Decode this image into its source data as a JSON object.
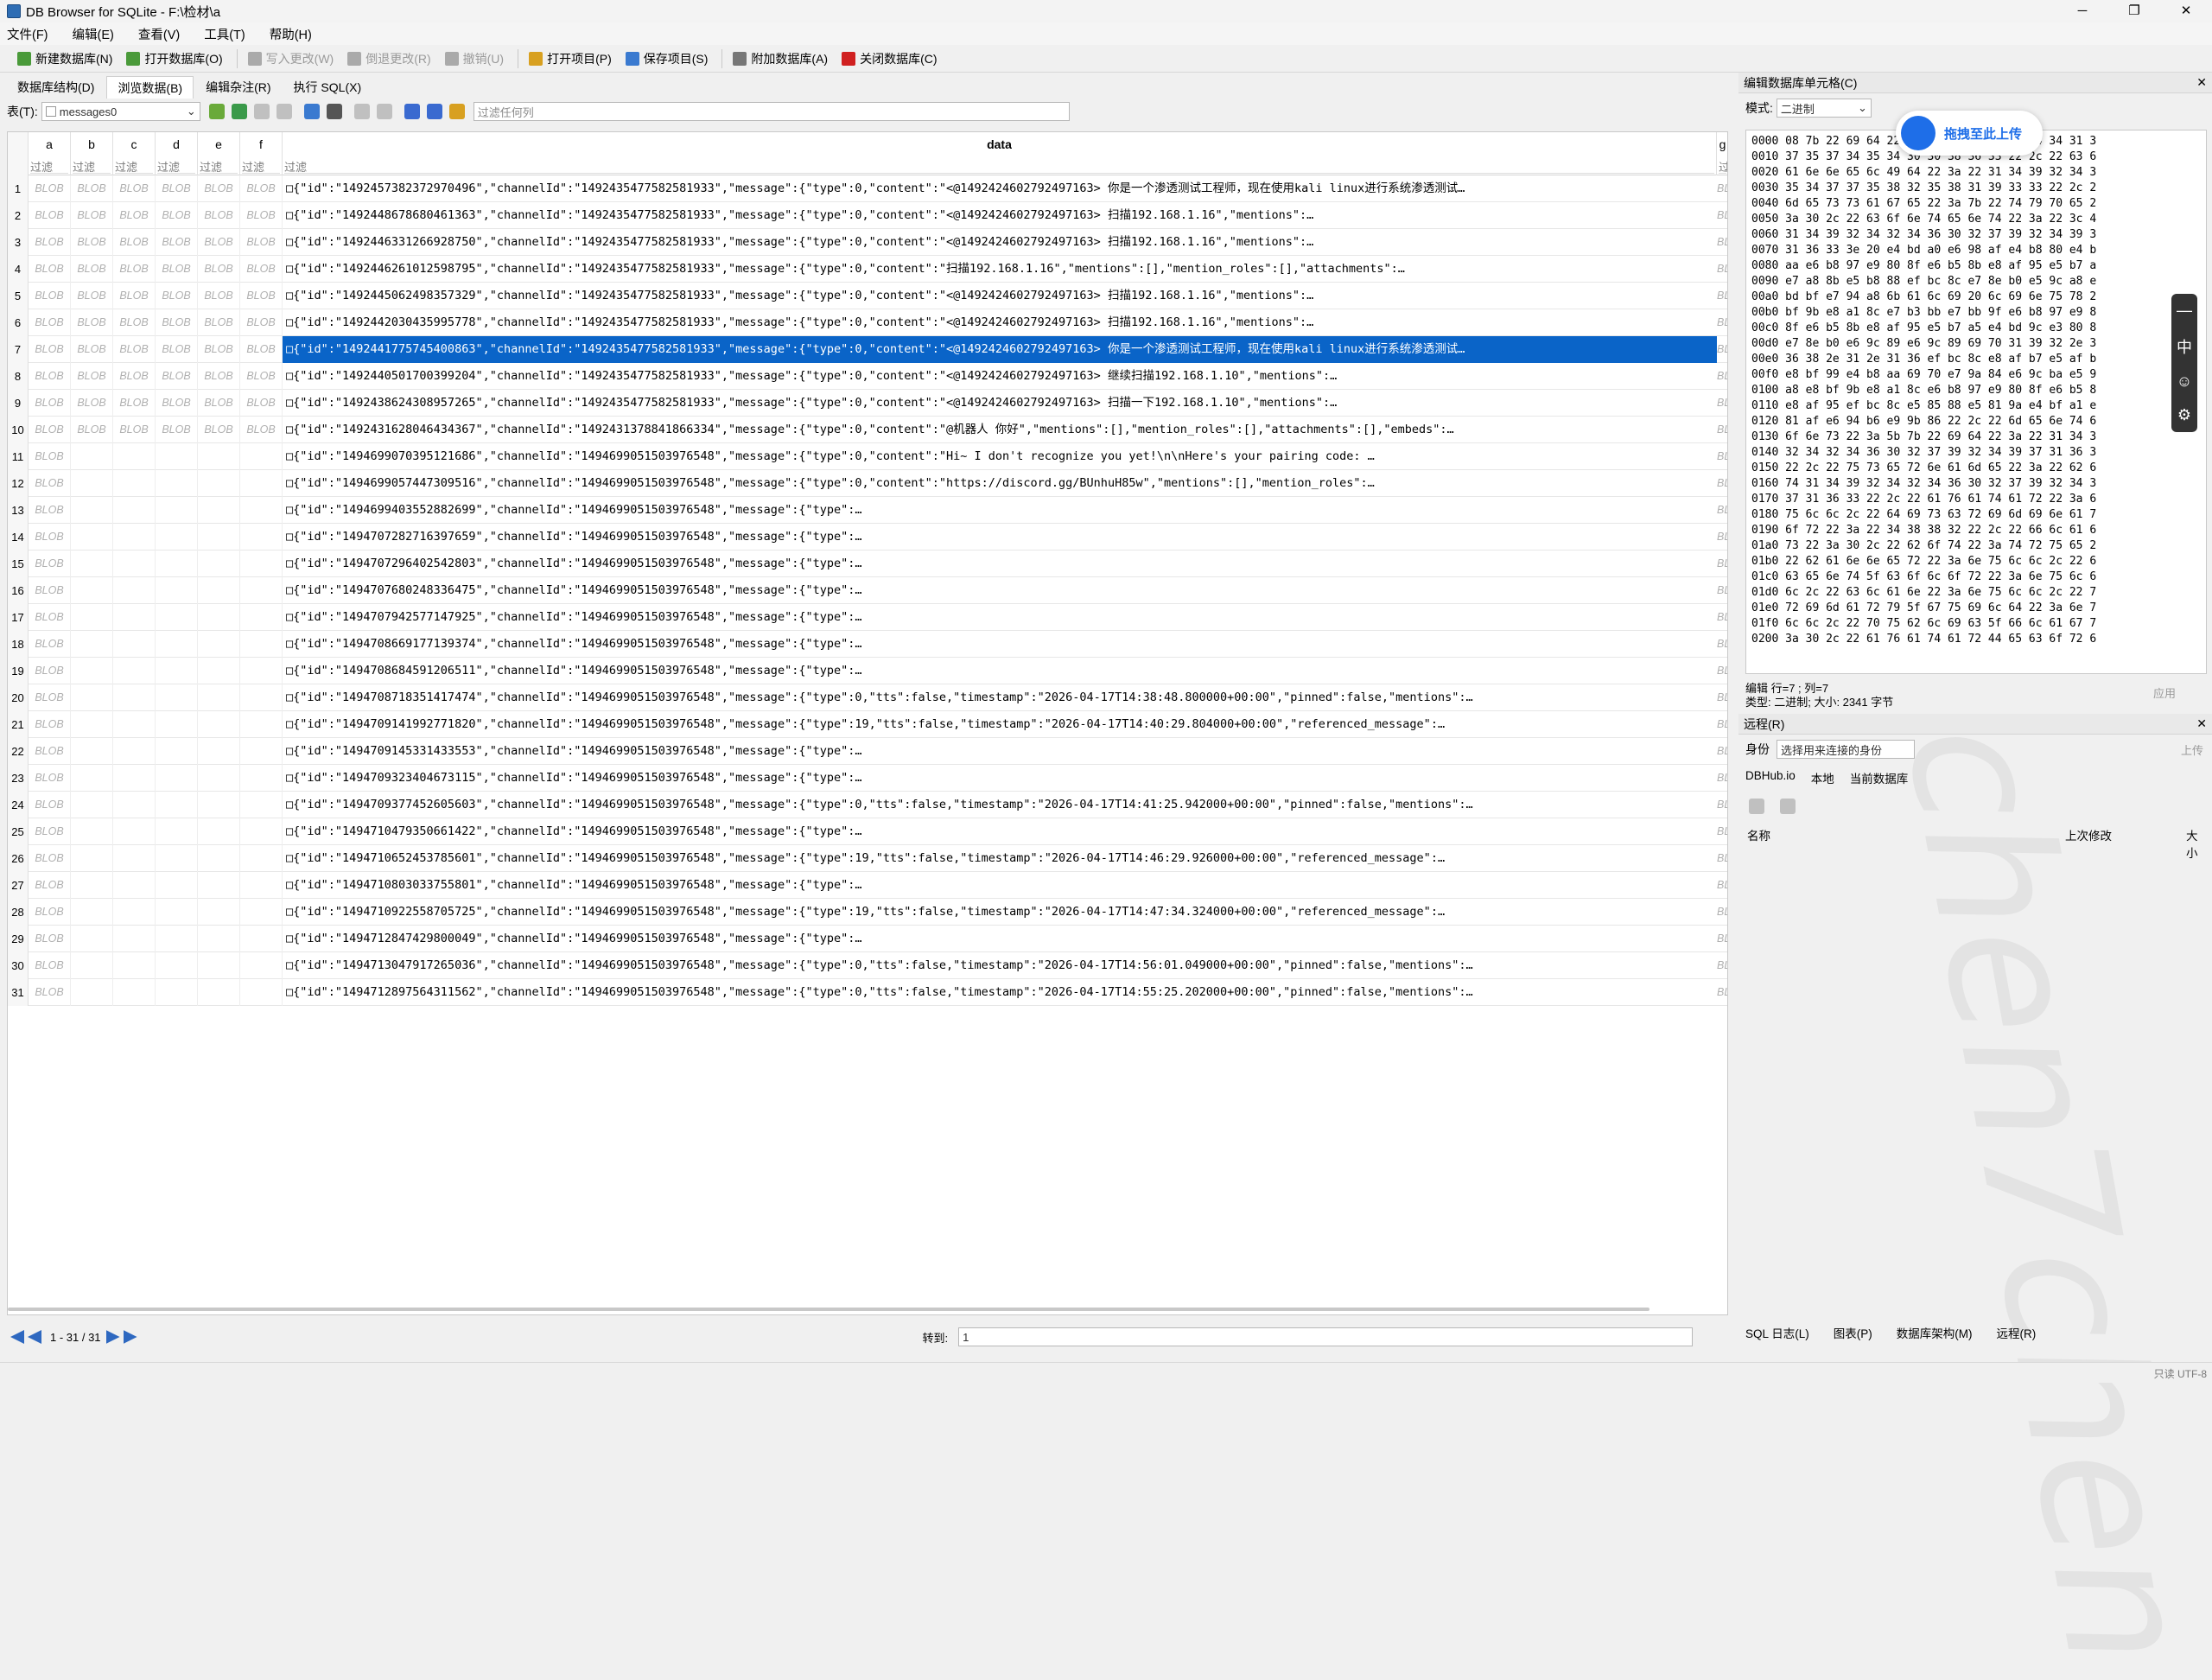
{
  "window": {
    "title": "DB Browser for SQLite - F:\\检材\\a",
    "min": "─",
    "max": "❐",
    "close": "✕"
  },
  "menu": [
    "文件(F)",
    "编辑(E)",
    "查看(V)",
    "工具(T)",
    "帮助(H)"
  ],
  "toolbar": [
    {
      "label": "新建数据库(N)",
      "color": "#4a9a3a",
      "disabled": false
    },
    {
      "label": "打开数据库(O)",
      "color": "#4a9a3a",
      "disabled": false
    },
    {
      "label": "写入更改(W)",
      "color": "#aaaaaa",
      "disabled": true
    },
    {
      "label": "倒退更改(R)",
      "color": "#aaaaaa",
      "disabled": true
    },
    {
      "label": "撤销(U)",
      "color": "#aaaaaa",
      "disabled": true
    },
    {
      "label": "打开项目(P)",
      "color": "#d8a020",
      "disabled": false
    },
    {
      "label": "保存项目(S)",
      "color": "#3a7ad0",
      "disabled": false
    },
    {
      "label": "附加数据库(A)",
      "color": "#777777",
      "disabled": false
    },
    {
      "label": "关闭数据库(C)",
      "color": "#d02020",
      "disabled": false
    }
  ],
  "tabs": [
    "数据库结构(D)",
    "浏览数据(B)",
    "编辑杂注(R)",
    "执行 SQL(X)"
  ],
  "filter": {
    "table_label": "表(T):",
    "table_value": "messages0",
    "filter_placeholder": "过滤任何列"
  },
  "columns": [
    "a",
    "b",
    "c",
    "d",
    "e",
    "f",
    "data",
    "g"
  ],
  "filter_label": "过滤",
  "blob": "BLOB",
  "rows": [
    {
      "n": "1",
      "full": true,
      "data": "□{\"id\":\"1492457382372970496\",\"channelId\":\"1492435477582581933\",\"message\":{\"type\":0,\"content\":\"<@1492424602792497163> 你是一个渗透测试工程师，现在使用kali linux进行系统渗透测试…"
    },
    {
      "n": "2",
      "full": true,
      "data": "□{\"id\":\"1492448678680461363\",\"channelId\":\"1492435477582581933\",\"message\":{\"type\":0,\"content\":\"<@1492424602792497163> 扫描192.168.1.16\",\"mentions\":…"
    },
    {
      "n": "3",
      "full": true,
      "data": "□{\"id\":\"1492446331266928750\",\"channelId\":\"1492435477582581933\",\"message\":{\"type\":0,\"content\":\"<@1492424602792497163> 扫描192.168.1.16\",\"mentions\":…"
    },
    {
      "n": "4",
      "full": true,
      "data": "□{\"id\":\"1492446261012598795\",\"channelId\":\"1492435477582581933\",\"message\":{\"type\":0,\"content\":\"扫描192.168.1.16\",\"mentions\":[],\"mention_roles\":[],\"attachments\":…"
    },
    {
      "n": "5",
      "full": true,
      "data": "□{\"id\":\"1492445062498357329\",\"channelId\":\"1492435477582581933\",\"message\":{\"type\":0,\"content\":\"<@1492424602792497163> 扫描192.168.1.16\",\"mentions\":…"
    },
    {
      "n": "6",
      "full": true,
      "data": "□{\"id\":\"1492442030435995778\",\"channelId\":\"1492435477582581933\",\"message\":{\"type\":0,\"content\":\"<@1492424602792497163> 扫描192.168.1.16\",\"mentions\":…"
    },
    {
      "n": "7",
      "full": true,
      "sel": true,
      "data": "□{\"id\":\"1492441775745400863\",\"channelId\":\"1492435477582581933\",\"message\":{\"type\":0,\"content\":\"<@1492424602792497163> 你是一个渗透测试工程师，现在使用kali linux进行系统渗透测试…"
    },
    {
      "n": "8",
      "full": true,
      "data": "□{\"id\":\"1492440501700399204\",\"channelId\":\"1492435477582581933\",\"message\":{\"type\":0,\"content\":\"<@1492424602792497163> 继续扫描192.168.1.10\",\"mentions\":…"
    },
    {
      "n": "9",
      "full": true,
      "data": "□{\"id\":\"1492438624308957265\",\"channelId\":\"1492435477582581933\",\"message\":{\"type\":0,\"content\":\"<@1492424602792497163> 扫描一下192.168.1.10\",\"mentions\":…"
    },
    {
      "n": "10",
      "full": true,
      "data": "□{\"id\":\"1492431628046434367\",\"channelId\":\"1492431378841866334\",\"message\":{\"type\":0,\"content\":\"@机器人 你好\",\"mentions\":[],\"mention_roles\":[],\"attachments\":[],\"embeds\":…"
    },
    {
      "n": "11",
      "full": false,
      "data": "□{\"id\":\"1494699070395121686\",\"channelId\":\"1494699051503976548\",\"message\":{\"type\":0,\"content\":\"Hi~ I don't recognize you yet!\\n\\nHere's your pairing code: …"
    },
    {
      "n": "12",
      "full": false,
      "data": "□{\"id\":\"1494699057447309516\",\"channelId\":\"1494699051503976548\",\"message\":{\"type\":0,\"content\":\"https://discord.gg/BUnhuH85w\",\"mentions\":[],\"mention_roles\":…"
    },
    {
      "n": "13",
      "full": false,
      "data": "□{\"id\":\"1494699403552882699\",\"channelId\":\"1494699051503976548\",\"message\":{\"type\":…"
    },
    {
      "n": "14",
      "full": false,
      "data": "□{\"id\":\"1494707282716397659\",\"channelId\":\"1494699051503976548\",\"message\":{\"type\":…"
    },
    {
      "n": "15",
      "full": false,
      "data": "□{\"id\":\"1494707296402542803\",\"channelId\":\"1494699051503976548\",\"message\":{\"type\":…"
    },
    {
      "n": "16",
      "full": false,
      "data": "□{\"id\":\"1494707680248336475\",\"channelId\":\"1494699051503976548\",\"message\":{\"type\":…"
    },
    {
      "n": "17",
      "full": false,
      "data": "□{\"id\":\"1494707942577147925\",\"channelId\":\"1494699051503976548\",\"message\":{\"type\":…"
    },
    {
      "n": "18",
      "full": false,
      "data": "□{\"id\":\"1494708669177139374\",\"channelId\":\"1494699051503976548\",\"message\":{\"type\":…"
    },
    {
      "n": "19",
      "full": false,
      "data": "□{\"id\":\"1494708684591206511\",\"channelId\":\"1494699051503976548\",\"message\":{\"type\":…"
    },
    {
      "n": "20",
      "full": false,
      "data": "□{\"id\":\"1494708718351417474\",\"channelId\":\"1494699051503976548\",\"message\":{\"type\":0,\"tts\":false,\"timestamp\":\"2026-04-17T14:38:48.800000+00:00\",\"pinned\":false,\"mentions\":…"
    },
    {
      "n": "21",
      "full": false,
      "data": "□{\"id\":\"1494709141992771820\",\"channelId\":\"1494699051503976548\",\"message\":{\"type\":19,\"tts\":false,\"timestamp\":\"2026-04-17T14:40:29.804000+00:00\",\"referenced_message\":…"
    },
    {
      "n": "22",
      "full": false,
      "data": "□{\"id\":\"1494709145331433553\",\"channelId\":\"1494699051503976548\",\"message\":{\"type\":…"
    },
    {
      "n": "23",
      "full": false,
      "data": "□{\"id\":\"1494709323404673115\",\"channelId\":\"1494699051503976548\",\"message\":{\"type\":…"
    },
    {
      "n": "24",
      "full": false,
      "data": "□{\"id\":\"1494709377452605603\",\"channelId\":\"1494699051503976548\",\"message\":{\"type\":0,\"tts\":false,\"timestamp\":\"2026-04-17T14:41:25.942000+00:00\",\"pinned\":false,\"mentions\":…"
    },
    {
      "n": "25",
      "full": false,
      "data": "□{\"id\":\"1494710479350661422\",\"channelId\":\"1494699051503976548\",\"message\":{\"type\":…"
    },
    {
      "n": "26",
      "full": false,
      "data": "□{\"id\":\"1494710652453785601\",\"channelId\":\"1494699051503976548\",\"message\":{\"type\":19,\"tts\":false,\"timestamp\":\"2026-04-17T14:46:29.926000+00:00\",\"referenced_message\":…"
    },
    {
      "n": "27",
      "full": false,
      "data": "□{\"id\":\"1494710803033755801\",\"channelId\":\"1494699051503976548\",\"message\":{\"type\":…"
    },
    {
      "n": "28",
      "full": false,
      "data": "□{\"id\":\"1494710922558705725\",\"channelId\":\"1494699051503976548\",\"message\":{\"type\":19,\"tts\":false,\"timestamp\":\"2026-04-17T14:47:34.324000+00:00\",\"referenced_message\":…"
    },
    {
      "n": "29",
      "full": false,
      "data": "□{\"id\":\"1494712847429800049\",\"channelId\":\"1494699051503976548\",\"message\":{\"type\":…"
    },
    {
      "n": "30",
      "full": false,
      "data": "□{\"id\":\"1494713047917265036\",\"channelId\":\"1494699051503976548\",\"message\":{\"type\":0,\"tts\":false,\"timestamp\":\"2026-04-17T14:56:01.049000+00:00\",\"pinned\":false,\"mentions\":…"
    },
    {
      "n": "31",
      "full": false,
      "data": "□{\"id\":\"1494712897564311562\",\"channelId\":\"1494699051503976548\",\"message\":{\"type\":0,\"tts\":false,\"timestamp\":\"2026-04-17T14:55:25.202000+00:00\",\"pinned\":false,\"mentions\":…"
    }
  ],
  "nav": {
    "range": "1 - 31 / 31",
    "goto_label": "转到:",
    "goto_value": "1"
  },
  "edit_cell": {
    "title": "编辑数据库单元格(C)",
    "mode_label": "模式:",
    "mode_value": "二进制",
    "edit_pos": "编辑 行=7 ; 列=7",
    "type_size": "类型: 二进制; 大小: 2341 字节",
    "apply": "应用",
    "hex": "0000 08 7b 22 69 64 22 3a 22 31 34 39 32 34 34 31 3\n0010 37 35 37 34 35 34 30 30 38 36 33 22 2c 22 63 6\n0020 61 6e 6e 65 6c 49 64 22 3a 22 31 34 39 32 34 3\n0030 35 34 37 37 35 38 32 35 38 31 39 33 33 22 2c 2\n0040 6d 65 73 73 61 67 65 22 3a 7b 22 74 79 70 65 2\n0050 3a 30 2c 22 63 6f 6e 74 65 6e 74 22 3a 22 3c 4\n0060 31 34 39 32 34 32 34 36 30 32 37 39 32 34 39 3\n0070 31 36 33 3e 20 e4 bd a0 e6 98 af e4 b8 80 e4 b\n0080 aa e6 b8 97 e9 80 8f e6 b5 8b e8 af 95 e5 b7 a\n0090 e7 a8 8b e5 b8 88 ef bc 8c e7 8e b0 e5 9c a8 e\n00a0 bd bf e7 94 a8 6b 61 6c 69 20 6c 69 6e 75 78 2\n00b0 bf 9b e8 a1 8c e7 b3 bb e7 bb 9f e6 b8 97 e9 8\n00c0 8f e6 b5 8b e8 af 95 e5 b7 a5 e4 bd 9c e3 80 8\n00d0 e7 8e b0 e6 9c 89 e6 9c 89 69 70 31 39 32 2e 3\n00e0 36 38 2e 31 2e 31 36 ef bc 8c e8 af b7 e5 af b\n00f0 e8 bf 99 e4 b8 aa 69 70 e7 9a 84 e6 9c ba e5 9\n0100 a8 e8 bf 9b e8 a1 8c e6 b8 97 e9 80 8f e6 b5 8\n0110 e8 af 95 ef bc 8c e5 85 88 e5 81 9a e4 bf a1 e\n0120 81 af e6 94 b6 e9 9b 86 22 2c 22 6d 65 6e 74 6\n0130 6f 6e 73 22 3a 5b 7b 22 69 64 22 3a 22 31 34 3\n0140 32 34 32 34 36 30 32 37 39 32 34 39 37 31 36 3\n0150 22 2c 22 75 73 65 72 6e 61 6d 65 22 3a 22 62 6\n0160 74 31 34 39 32 34 32 34 36 30 32 37 39 32 34 3\n0170 37 31 36 33 22 2c 22 61 76 61 74 61 72 22 3a 6\n0180 75 6c 6c 2c 22 64 69 73 63 72 69 6d 69 6e 61 7\n0190 6f 72 22 3a 22 34 38 38 32 22 2c 22 66 6c 61 6\n01a0 73 22 3a 30 2c 22 62 6f 74 22 3a 74 72 75 65 2\n01b0 22 62 61 6e 6e 65 72 22 3a 6e 75 6c 6c 2c 22 6\n01c0 63 65 6e 74 5f 63 6f 6c 6f 72 22 3a 6e 75 6c 6\n01d0 6c 2c 22 63 6c 61 6e 22 3a 6e 75 6c 6c 2c 22 7\n01e0 72 69 6d 61 72 79 5f 67 75 69 6c 64 22 3a 6e 7\n01f0 6c 6c 2c 22 70 75 62 6c 69 63 5f 66 6c 61 67 7\n0200 3a 30 2c 22 61 76 61 74 61 72 44 65 63 6f 72 6"
  },
  "dbhub_popup": "拖拽至此上传",
  "float_bar": [
    "—",
    "中",
    "☺",
    "⚙"
  ],
  "remote": {
    "title": "远程(R)",
    "identity_label": "身份",
    "identity_value": "选择用来连接的身份",
    "upload": "上传",
    "tabs": [
      "DBHub.io",
      "本地",
      "当前数据库"
    ],
    "cols": [
      "名称",
      "上次修改",
      "大小"
    ]
  },
  "bottom_tabs": [
    "SQL 日志(L)",
    "图表(P)",
    "数据库架构(M)",
    "远程(R)"
  ],
  "status": "只读 UTF-8",
  "watermark": "chen7chen"
}
